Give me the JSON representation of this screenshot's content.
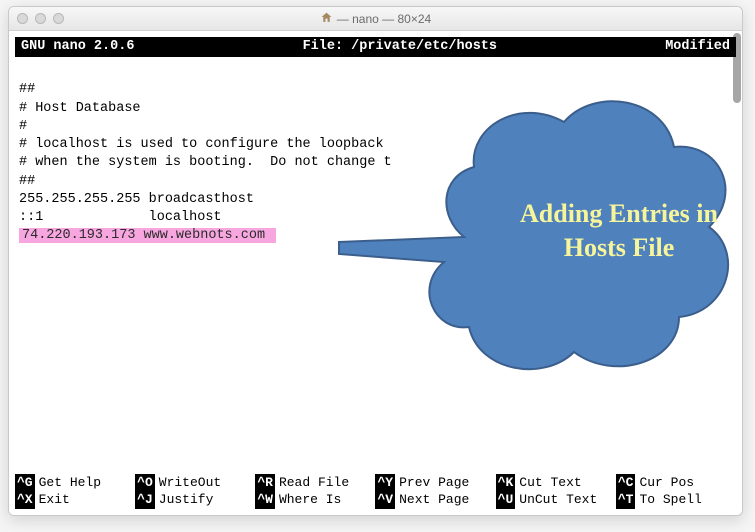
{
  "window": {
    "title": " — nano — 80×24"
  },
  "statusbar": {
    "left": "GNU nano 2.0.6",
    "center": "File: /private/etc/hosts",
    "right": "Modified"
  },
  "file_lines": [
    "##",
    "# Host Database",
    "#",
    "# localhost is used to configure the loopback ",
    "# when the system is booting.  Do not change t",
    "##",
    "255.255.255.255 broadcasthost",
    "::1             localhost"
  ],
  "highlighted_line": "74.220.193.173 www.webnots.com ",
  "shortcuts": [
    {
      "key": "^G",
      "label": "Get Help"
    },
    {
      "key": "^O",
      "label": "WriteOut"
    },
    {
      "key": "^R",
      "label": "Read File"
    },
    {
      "key": "^Y",
      "label": "Prev Page"
    },
    {
      "key": "^K",
      "label": "Cut Text"
    },
    {
      "key": "^C",
      "label": "Cur Pos"
    },
    {
      "key": "^X",
      "label": "Exit"
    },
    {
      "key": "^J",
      "label": "Justify"
    },
    {
      "key": "^W",
      "label": "Where Is"
    },
    {
      "key": "^V",
      "label": "Next Page"
    },
    {
      "key": "^U",
      "label": "UnCut Text"
    },
    {
      "key": "^T",
      "label": "To Spell"
    }
  ],
  "callout": {
    "text": "Adding Entries in Hosts File",
    "colors": {
      "fill": "#4f81bd",
      "stroke": "#3b5e8c",
      "text": "#f7f59b"
    }
  }
}
